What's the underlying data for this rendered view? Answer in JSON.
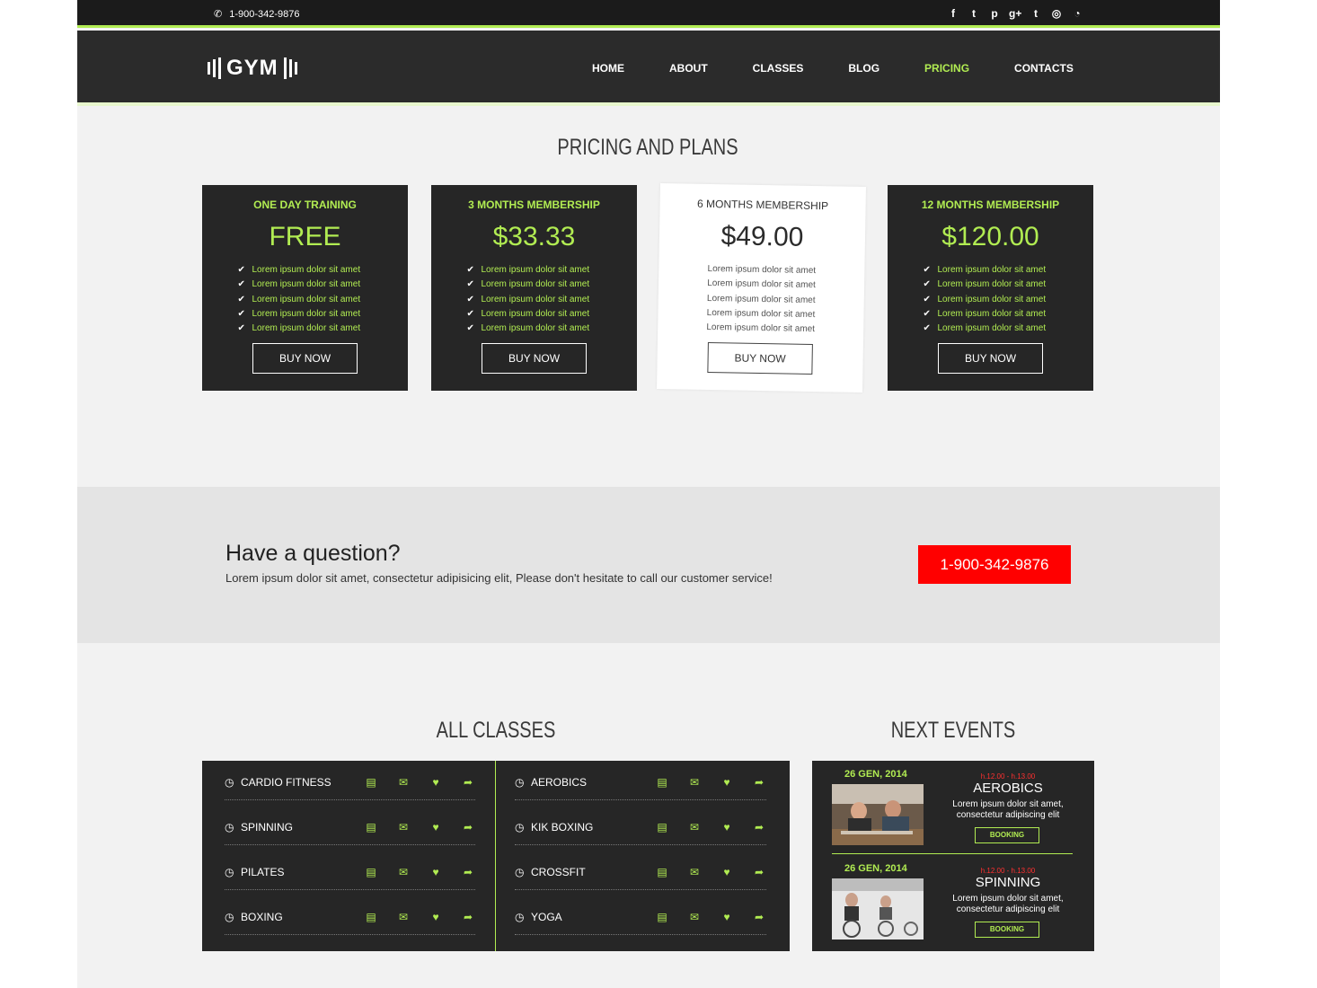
{
  "topbar": {
    "phone": "1-900-342-9876",
    "social": [
      {
        "icon": "facebook-icon",
        "glyph": "f"
      },
      {
        "icon": "twitter-icon",
        "glyph": "t"
      },
      {
        "icon": "pinterest-icon",
        "glyph": "p"
      },
      {
        "icon": "google-plus-icon",
        "glyph": "g+"
      },
      {
        "icon": "tumblr-icon",
        "glyph": "t"
      },
      {
        "icon": "instagram-icon",
        "glyph": "◎"
      },
      {
        "icon": "rss-icon",
        "glyph": "◔"
      }
    ]
  },
  "header": {
    "logo": "GYM",
    "nav": [
      "HOME",
      "ABOUT",
      "CLASSES",
      "BLOG",
      "PRICING",
      "CONTACTS"
    ],
    "active": "PRICING"
  },
  "pricing": {
    "title": "PRICING AND PLANS",
    "plans": [
      {
        "name": "ONE DAY TRAINING",
        "price": "FREE",
        "features": [
          "Lorem ipsum dolor sit amet",
          "Lorem ipsum dolor sit amet",
          "Lorem ipsum dolor sit amet",
          "Lorem ipsum dolor sit amet",
          "Lorem ipsum dolor sit amet"
        ],
        "button": "BUY NOW"
      },
      {
        "name": "3 MONTHS MEMBERSHIP",
        "price": "$33.33",
        "features": [
          "Lorem ipsum dolor sit amet",
          "Lorem ipsum dolor sit amet",
          "Lorem ipsum dolor sit amet",
          "Lorem ipsum dolor sit amet",
          "Lorem ipsum dolor sit amet"
        ],
        "button": "BUY NOW"
      },
      {
        "name": "6 MONTHS MEMBERSHIP",
        "price": "$49.00",
        "features": [
          "Lorem ipsum dolor sit amet",
          "Lorem ipsum dolor sit amet",
          "Lorem ipsum dolor sit amet",
          "Lorem ipsum dolor sit amet",
          "Lorem ipsum dolor sit amet"
        ],
        "button": "BUY NOW"
      },
      {
        "name": "12 MONTHS MEMBERSHIP",
        "price": "$120.00",
        "features": [
          "Lorem ipsum dolor sit amet",
          "Lorem ipsum dolor sit amet",
          "Lorem ipsum dolor sit amet",
          "Lorem ipsum dolor sit amet",
          "Lorem ipsum dolor sit amet"
        ],
        "button": "BUY NOW"
      }
    ]
  },
  "question": {
    "title": "Have a question?",
    "text": "Lorem ipsum dolor sit amet, consectetur adipisicing elit, Please don't hesitate to call our customer service!",
    "phone_button": "1-900-342-9876"
  },
  "classes": {
    "title": "ALL CLASSES",
    "left": [
      "CARDIO FITNESS",
      "SPINNING",
      "PILATES",
      "BOXING"
    ],
    "right": [
      "AEROBICS",
      "KIK BOXING",
      "CROSSFIT",
      "YOGA"
    ],
    "row_icons": [
      "laptop-icon",
      "envelope-icon",
      "heart-icon",
      "share-icon"
    ]
  },
  "events": {
    "title": "NEXT EVENTS",
    "items": [
      {
        "date": "26 GEN, 2014",
        "time": "h.12.00 - h.13.00",
        "name": "AEROBICS",
        "desc": "Lorem ipsum dolor sit amet, consectetur adipiscing elit",
        "button": "BOOKING"
      },
      {
        "date": "26 GEN, 2014",
        "time": "h.12.00 - h.13.00",
        "name": "SPINNING",
        "desc": "Lorem ipsum dolor sit amet, consectetur adipiscing elit",
        "button": "BOOKING"
      }
    ]
  },
  "colors": {
    "accent": "#b1ec52",
    "dark": "#262626",
    "call": "#ff0000"
  }
}
